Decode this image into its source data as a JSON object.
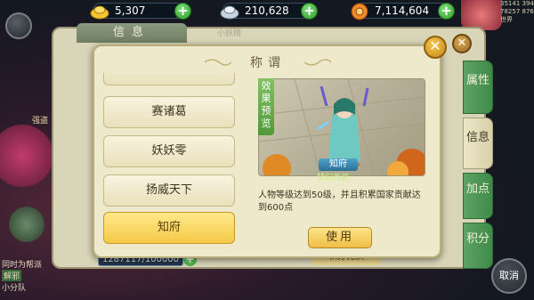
{
  "currencies": [
    {
      "icon": "gold-ingot-icon",
      "value": "5,307"
    },
    {
      "icon": "silver-ingot-icon",
      "value": "210,628"
    },
    {
      "icon": "coin-icon",
      "value": "7,114,604"
    }
  ],
  "top_right": {
    "line1": "35141 394",
    "line2": "78257 876",
    "line3": "世界"
  },
  "back_panel": {
    "title": "信息",
    "subtitle": "小妖精",
    "side_tabs": [
      "属性",
      "信息",
      "加点",
      "积分"
    ],
    "progress": "1287117/100000",
    "bottom_button": "积分兑换",
    "left_tags": [
      "强盗",
      "同时为帮派",
      "解邪",
      "小分队"
    ]
  },
  "cancel_label": "取消",
  "modal": {
    "title": "称谓",
    "close_label": "✕",
    "titles": [
      {
        "label": "赛诸葛",
        "selected": false
      },
      {
        "label": "妖妖零",
        "selected": false
      },
      {
        "label": "扬威天下",
        "selected": false
      },
      {
        "label": "知府",
        "selected": true
      }
    ],
    "preview_label": [
      "效",
      "果",
      "预",
      "览"
    ],
    "char_badge": "知府",
    "char_name": "梦幻西游",
    "description": "人物等级达到50级，并且积累国家贡献达到600点",
    "use_button": "使用"
  },
  "colors": {
    "accent_green": "#3f8a49",
    "selected_gold": "#f5c948",
    "panel_bg": "#efe9cc"
  }
}
